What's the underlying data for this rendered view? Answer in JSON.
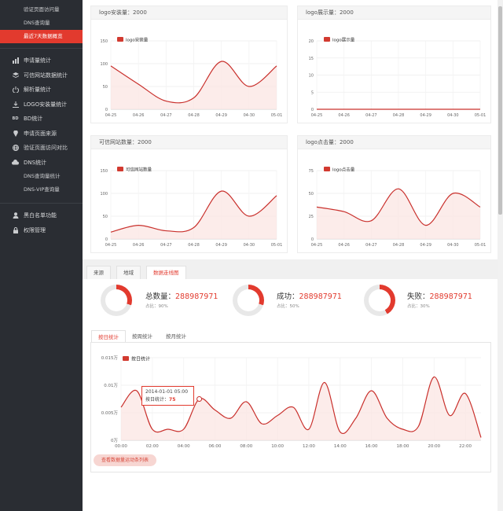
{
  "sidebar": {
    "top_subitems": [
      "验证页面访问量",
      "DNS查询量",
      "最近7天数据概览"
    ],
    "items": [
      {
        "label": "申请量统计",
        "icon": "chart-icon"
      },
      {
        "label": "可信网站数据统计",
        "icon": "layers-icon"
      },
      {
        "label": "解析量统计",
        "icon": "power-icon"
      },
      {
        "label": "LOGO安装量统计",
        "icon": "download-icon"
      },
      {
        "label": "BD统计",
        "icon": "bd-icon"
      },
      {
        "label": "申请页面来源",
        "icon": "location-pin-icon"
      },
      {
        "label": "验证页面访问对比",
        "icon": "globe-icon"
      },
      {
        "label": "DNS统计",
        "icon": "cloud-icon"
      }
    ],
    "dns_subitems": [
      "DNS查询量统计",
      "DNS-VIP查询量"
    ],
    "bottom_items": [
      {
        "label": "黑白名单功能",
        "icon": "user-icon"
      },
      {
        "label": "权限管理",
        "icon": "lock-icon"
      }
    ],
    "accent": "#e23a2e"
  },
  "cards": [
    {
      "title": "logo安装量：2000"
    },
    {
      "title": "logo展示量：2000"
    },
    {
      "title": "可信网站数量：2000"
    },
    {
      "title": "logo点击量：2000"
    }
  ],
  "tabs": [
    "来源",
    "地域",
    "数据走线图"
  ],
  "stats": [
    {
      "label": "总数量：",
      "value": "288987971",
      "sub": "占比：90%",
      "percent": 0.3
    },
    {
      "label": "成功：",
      "value": "288987971",
      "sub": "占比：50%",
      "percent": 0.3
    },
    {
      "label": "失败：",
      "value": "288987971",
      "sub": "占比：30%",
      "percent": 0.42
    }
  ],
  "subtabs": [
    "按日统计",
    "按周统计",
    "按月统计"
  ],
  "tooltip": {
    "time": "2014-01-01 05:00",
    "label": "按日统计：",
    "value": "75"
  },
  "button_label": "查看数据量运动条列表",
  "chart_data": [
    {
      "type": "area",
      "x": [
        "04-25",
        "04-26",
        "04-27",
        "04-28",
        "04-29",
        "04-30",
        "05-01"
      ],
      "series": [
        {
          "name": "logo安装量",
          "values": [
            95,
            55,
            18,
            25,
            105,
            50,
            95
          ]
        }
      ],
      "yticks": [
        0,
        50,
        100,
        150
      ],
      "ylim": [
        0,
        150
      ]
    },
    {
      "type": "area",
      "x": [
        "04-25",
        "04-26",
        "04-27",
        "04-28",
        "04-29",
        "04-30",
        "05-01"
      ],
      "series": [
        {
          "name": "logo展示量",
          "values": [
            0,
            0,
            0,
            0,
            0,
            0,
            0
          ]
        }
      ],
      "yticks": [
        0,
        5,
        10,
        15,
        20
      ],
      "ylim": [
        0,
        20
      ]
    },
    {
      "type": "area",
      "x": [
        "04-25",
        "04-26",
        "04-27",
        "04-28",
        "04-29",
        "04-30",
        "05-01"
      ],
      "series": [
        {
          "name": "可信网站数量",
          "values": [
            15,
            30,
            18,
            25,
            105,
            50,
            95
          ]
        }
      ],
      "yticks": [
        0,
        50,
        100,
        150
      ],
      "ylim": [
        0,
        150
      ]
    },
    {
      "type": "area",
      "x": [
        "04-25",
        "04-26",
        "04-27",
        "04-28",
        "04-29",
        "04-30",
        "05-01"
      ],
      "series": [
        {
          "name": "logo点击量",
          "values": [
            35,
            30,
            20,
            55,
            15,
            50,
            35
          ]
        }
      ],
      "yticks": [
        0,
        25,
        50,
        75
      ],
      "ylim": [
        0,
        75
      ]
    },
    {
      "type": "area",
      "x": [
        "00:00",
        "01:00",
        "02:00",
        "03:00",
        "04:00",
        "05:00",
        "06:00",
        "07:00",
        "08:00",
        "09:00",
        "10:00",
        "11:00",
        "12:00",
        "13:00",
        "14:00",
        "15:00",
        "16:00",
        "17:00",
        "18:00",
        "19:00",
        "20:00",
        "21:00",
        "22:00",
        "23:00"
      ],
      "xtick_labels": [
        "00:00",
        "02:00",
        "04:00",
        "06:00",
        "08:00",
        "10:00",
        "12:00",
        "14:00",
        "16:00",
        "18:00",
        "20:00",
        "22:00"
      ],
      "series": [
        {
          "name": "按日统计",
          "values": [
            60,
            90,
            20,
            20,
            20,
            75,
            55,
            40,
            70,
            30,
            45,
            60,
            20,
            105,
            15,
            40,
            90,
            40,
            20,
            25,
            115,
            45,
            85,
            5
          ]
        }
      ],
      "yticks": [
        "0万",
        "0.005万",
        "0.01万",
        "0.015万"
      ],
      "ylim": [
        0,
        150
      ]
    }
  ]
}
